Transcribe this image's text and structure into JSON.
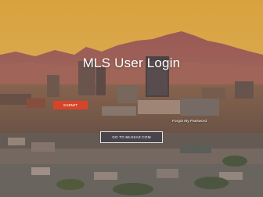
{
  "page": {
    "title": "MLS User Login"
  },
  "form": {
    "username_value": "",
    "password_value": "",
    "submit_label": "SUBMIT",
    "forgot_label": "Forgot My Password",
    "goto_label": "GO TO MLSSAZ.COM"
  },
  "colors": {
    "accent": "#d8442a",
    "sky_top": "#e6b24a",
    "sky_bottom": "#d39a5c",
    "mountain": "#a05a52",
    "city": "#6e5a4e"
  }
}
